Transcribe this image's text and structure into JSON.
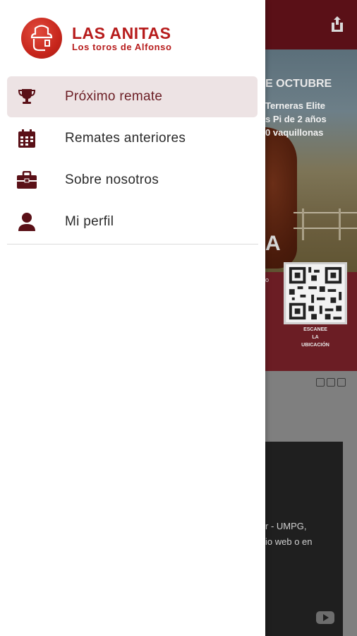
{
  "drawer": {
    "brand": {
      "name": "LAS ANITAS",
      "tagline": "Los toros de Alfonso"
    },
    "menu": [
      {
        "label": "Próximo remate",
        "icon": "trophy-icon",
        "active": true
      },
      {
        "label": "Remates anteriores",
        "icon": "calendar-icon",
        "active": false
      },
      {
        "label": "Sobre nosotros",
        "icon": "briefcase-icon",
        "active": false
      },
      {
        "label": "Mi perfil",
        "icon": "person-icon",
        "active": false
      }
    ]
  },
  "background": {
    "banner": {
      "title": "E OCTUBRE",
      "line1": "Terneras Elite",
      "line2": "s Pi de 2 años",
      "line3": "0 vaquillonas",
      "big_letter": "A"
    },
    "qr_caption_1": "ESCANEE",
    "qr_caption_2": "LA",
    "qr_caption_3": "UBICACIÓN",
    "video_text_1": "r - UMPG,",
    "video_text_2": "io web o en"
  },
  "colors": {
    "brand_red": "#b71c1c",
    "header_dark": "#5a1017",
    "active_bg": "#ede3e4",
    "icon_color": "#5a1017"
  }
}
